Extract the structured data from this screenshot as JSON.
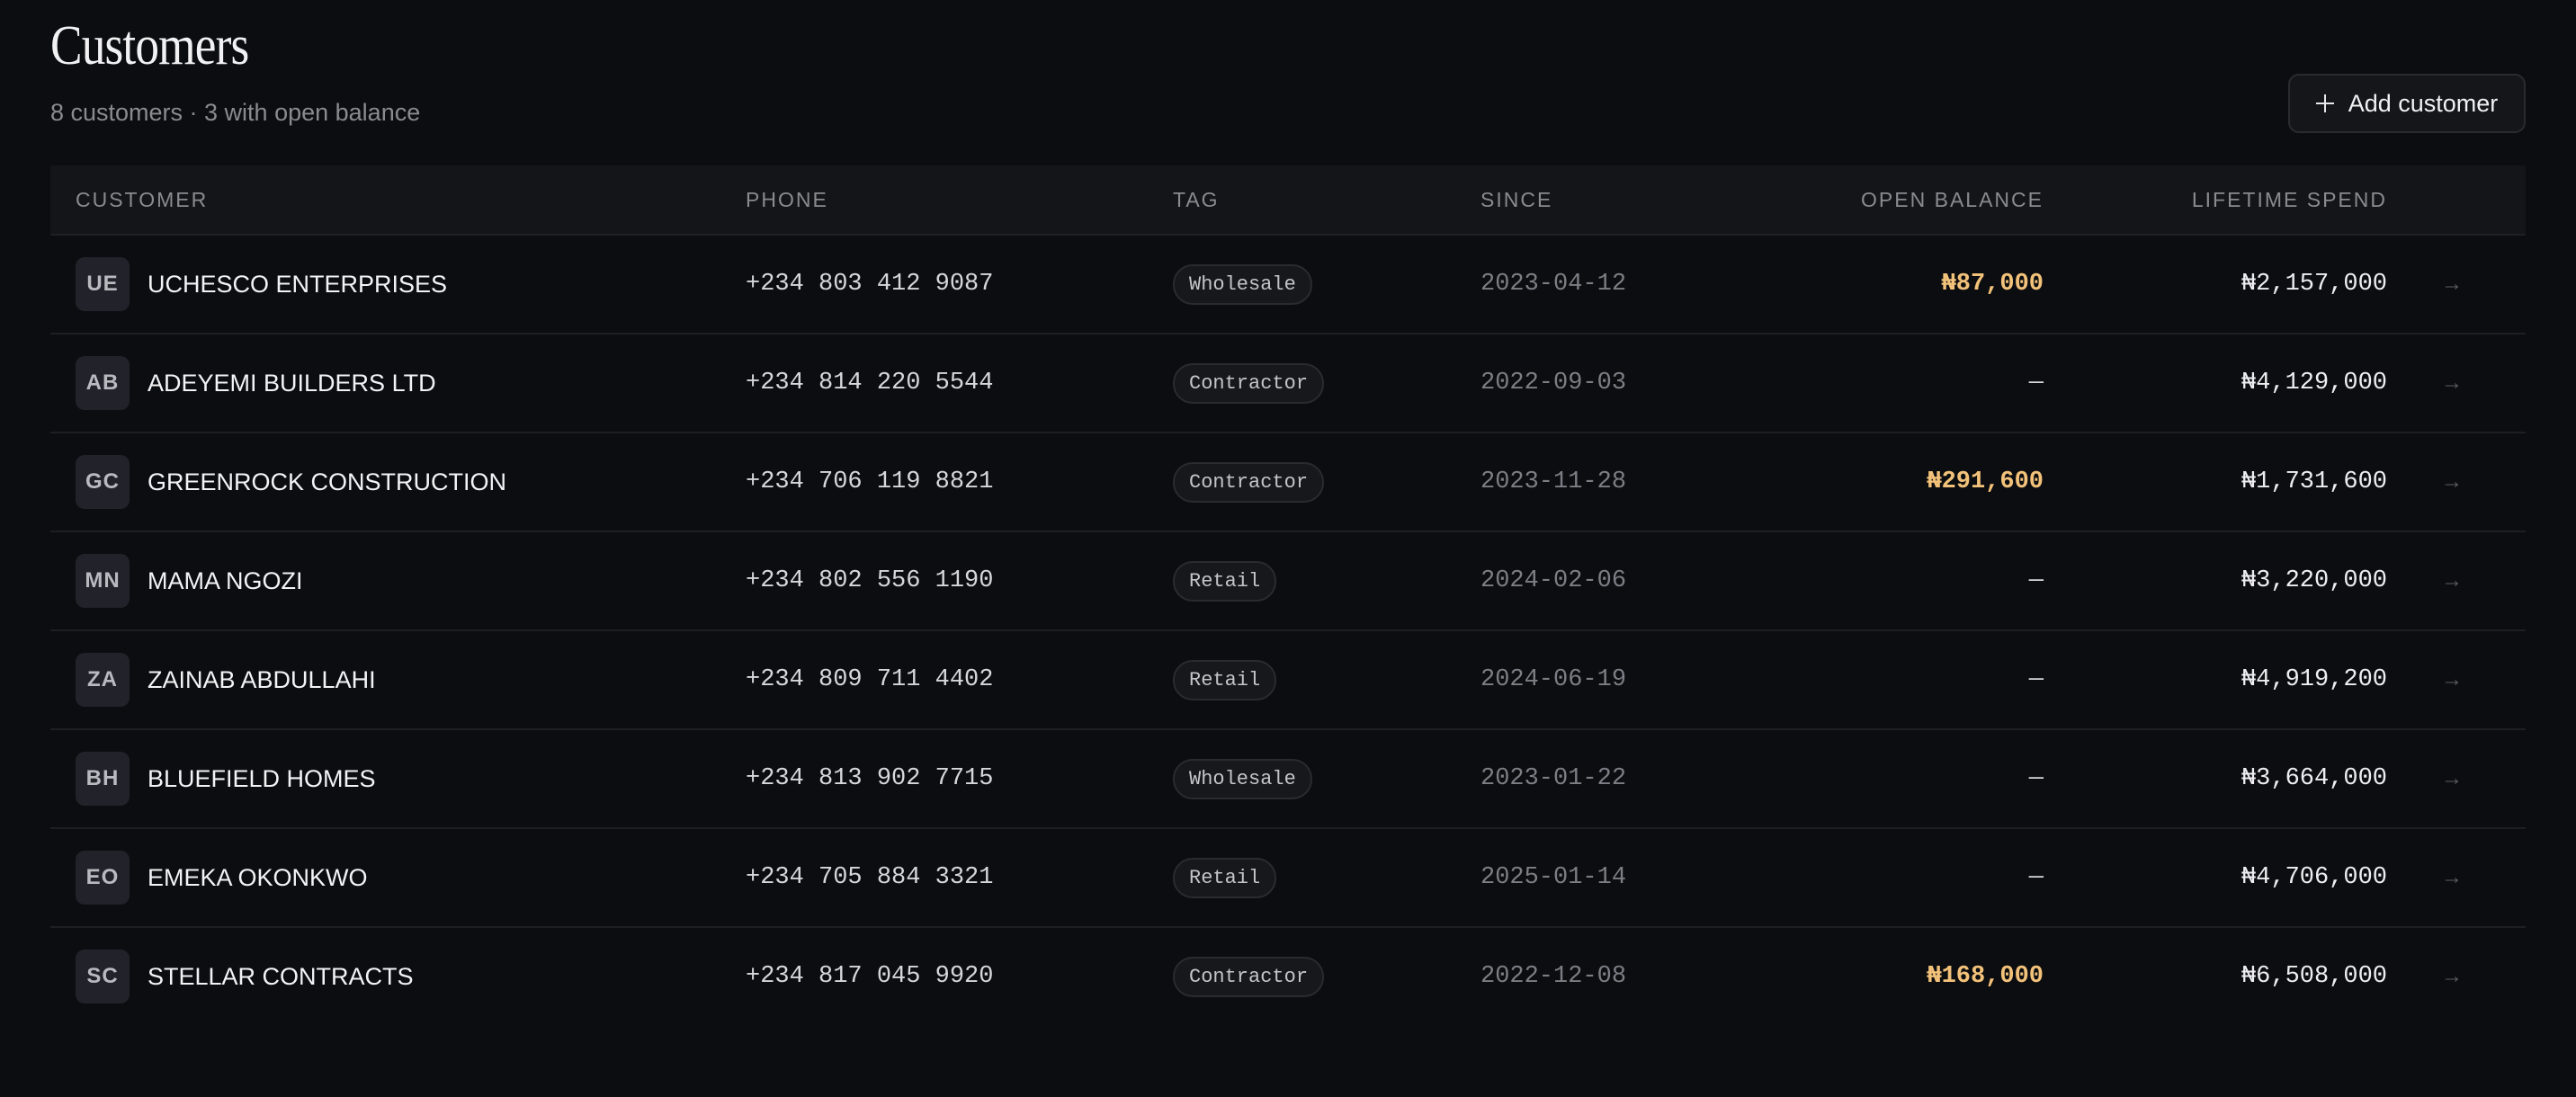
{
  "header": {
    "title": "Customers",
    "subtitle": "8 customers · 3 with open balance",
    "add_button_label": "Add customer"
  },
  "table": {
    "columns": {
      "customer": "CUSTOMER",
      "phone": "PHONE",
      "tag": "TAG",
      "since": "SINCE",
      "open_balance": "OPEN BALANCE",
      "lifetime_spend": "LIFETIME SPEND"
    },
    "rows": [
      {
        "initials": "UE",
        "name": "UCHESCO ENTERPRISES",
        "phone": "+234 803 412 9087",
        "tag": "Wholesale",
        "since": "2023-04-12",
        "open_balance": "₦87,000",
        "lifetime_spend": "₦2,157,000"
      },
      {
        "initials": "AB",
        "name": "ADEYEMI BUILDERS LTD",
        "phone": "+234 814 220 5544",
        "tag": "Contractor",
        "since": "2022-09-03",
        "open_balance": "—",
        "lifetime_spend": "₦4,129,000"
      },
      {
        "initials": "GC",
        "name": "GREENROCK CONSTRUCTION",
        "phone": "+234 706 119 8821",
        "tag": "Contractor",
        "since": "2023-11-28",
        "open_balance": "₦291,600",
        "lifetime_spend": "₦1,731,600"
      },
      {
        "initials": "MN",
        "name": "MAMA NGOZI",
        "phone": "+234 802 556 1190",
        "tag": "Retail",
        "since": "2024-02-06",
        "open_balance": "—",
        "lifetime_spend": "₦3,220,000"
      },
      {
        "initials": "ZA",
        "name": "ZAINAB ABDULLAHI",
        "phone": "+234 809 711 4402",
        "tag": "Retail",
        "since": "2024-06-19",
        "open_balance": "—",
        "lifetime_spend": "₦4,919,200"
      },
      {
        "initials": "BH",
        "name": "BLUEFIELD HOMES",
        "phone": "+234 813 902 7715",
        "tag": "Wholesale",
        "since": "2023-01-22",
        "open_balance": "—",
        "lifetime_spend": "₦3,664,000"
      },
      {
        "initials": "EO",
        "name": "EMEKA OKONKWO",
        "phone": "+234 705 884 3321",
        "tag": "Retail",
        "since": "2025-01-14",
        "open_balance": "—",
        "lifetime_spend": "₦4,706,000"
      },
      {
        "initials": "SC",
        "name": "STELLAR CONTRACTS",
        "phone": "+234 817 045 9920",
        "tag": "Contractor",
        "since": "2022-12-08",
        "open_balance": "₦168,000",
        "lifetime_spend": "₦6,508,000"
      }
    ]
  },
  "icons": {
    "add": "plus-icon",
    "row_action": "arrow-right-icon"
  },
  "colors": {
    "background": "#0c0d10",
    "balance_due": "#f3c27a"
  }
}
